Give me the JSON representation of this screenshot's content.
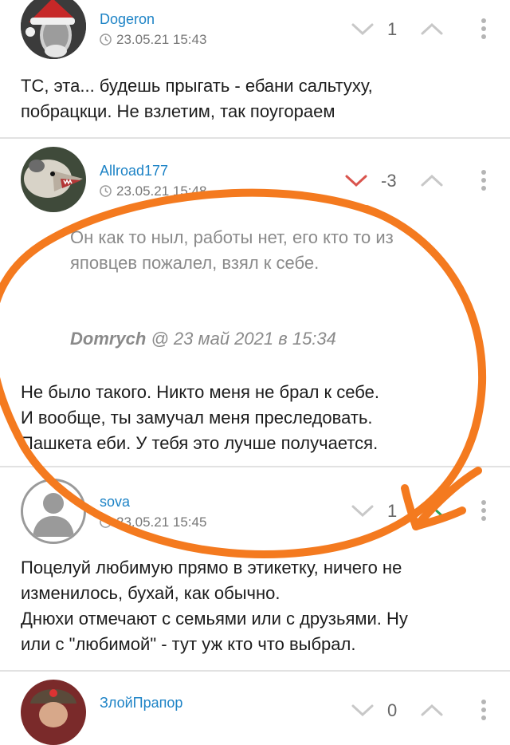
{
  "colors": {
    "link": "#1d83c6",
    "downvote_active": "#d9544d",
    "upvote_active": "#2aa35a",
    "vote_inactive": "#c8c8c8",
    "annotation": "#f47a1f"
  },
  "comments": [
    {
      "author": "Dogeron",
      "timestamp": "23.05.21 15:43",
      "score": "1",
      "avatar_icon": "santa-hat-avatar-icon",
      "lines": [
        "ТС, эта... будешь прыгать - ебани сальтуху,",
        "побрацкци. Не взлетим, так поугораем"
      ]
    },
    {
      "author": "Allroad177",
      "timestamp": "23.05.21 15:48",
      "score": "-3",
      "avatar_icon": "opossum-avatar-icon",
      "quote_lines": [
        "Он как то ныл, работы нет, его кто то из",
        "яповцев пожалел, взял к себе."
      ],
      "quote_author": "Domrych",
      "quote_date": "@ 23 май 2021 в 15:34",
      "lines": [
        "Не было такого. Никто меня не брал к себе.",
        "И вообще, ты замучал меня преследовать.",
        "Пашкета еби. У тебя это лучше получается."
      ]
    },
    {
      "author": "sova",
      "timestamp": "23.05.21 15:45",
      "score": "1",
      "avatar_icon": "default-user-avatar-icon",
      "lines": [
        "Поцелуй любимую прямо в этикетку, ничего не",
        "изменилось, бухай, как обычно.",
        "Днюхи отмечают с семьями или с друзьями. Ну",
        "или с \"любимой\" - тут уж кто что выбрал."
      ]
    },
    {
      "author": "ЗлойПрапор",
      "score": "0",
      "avatar_icon": "soldier-avatar-icon"
    }
  ]
}
